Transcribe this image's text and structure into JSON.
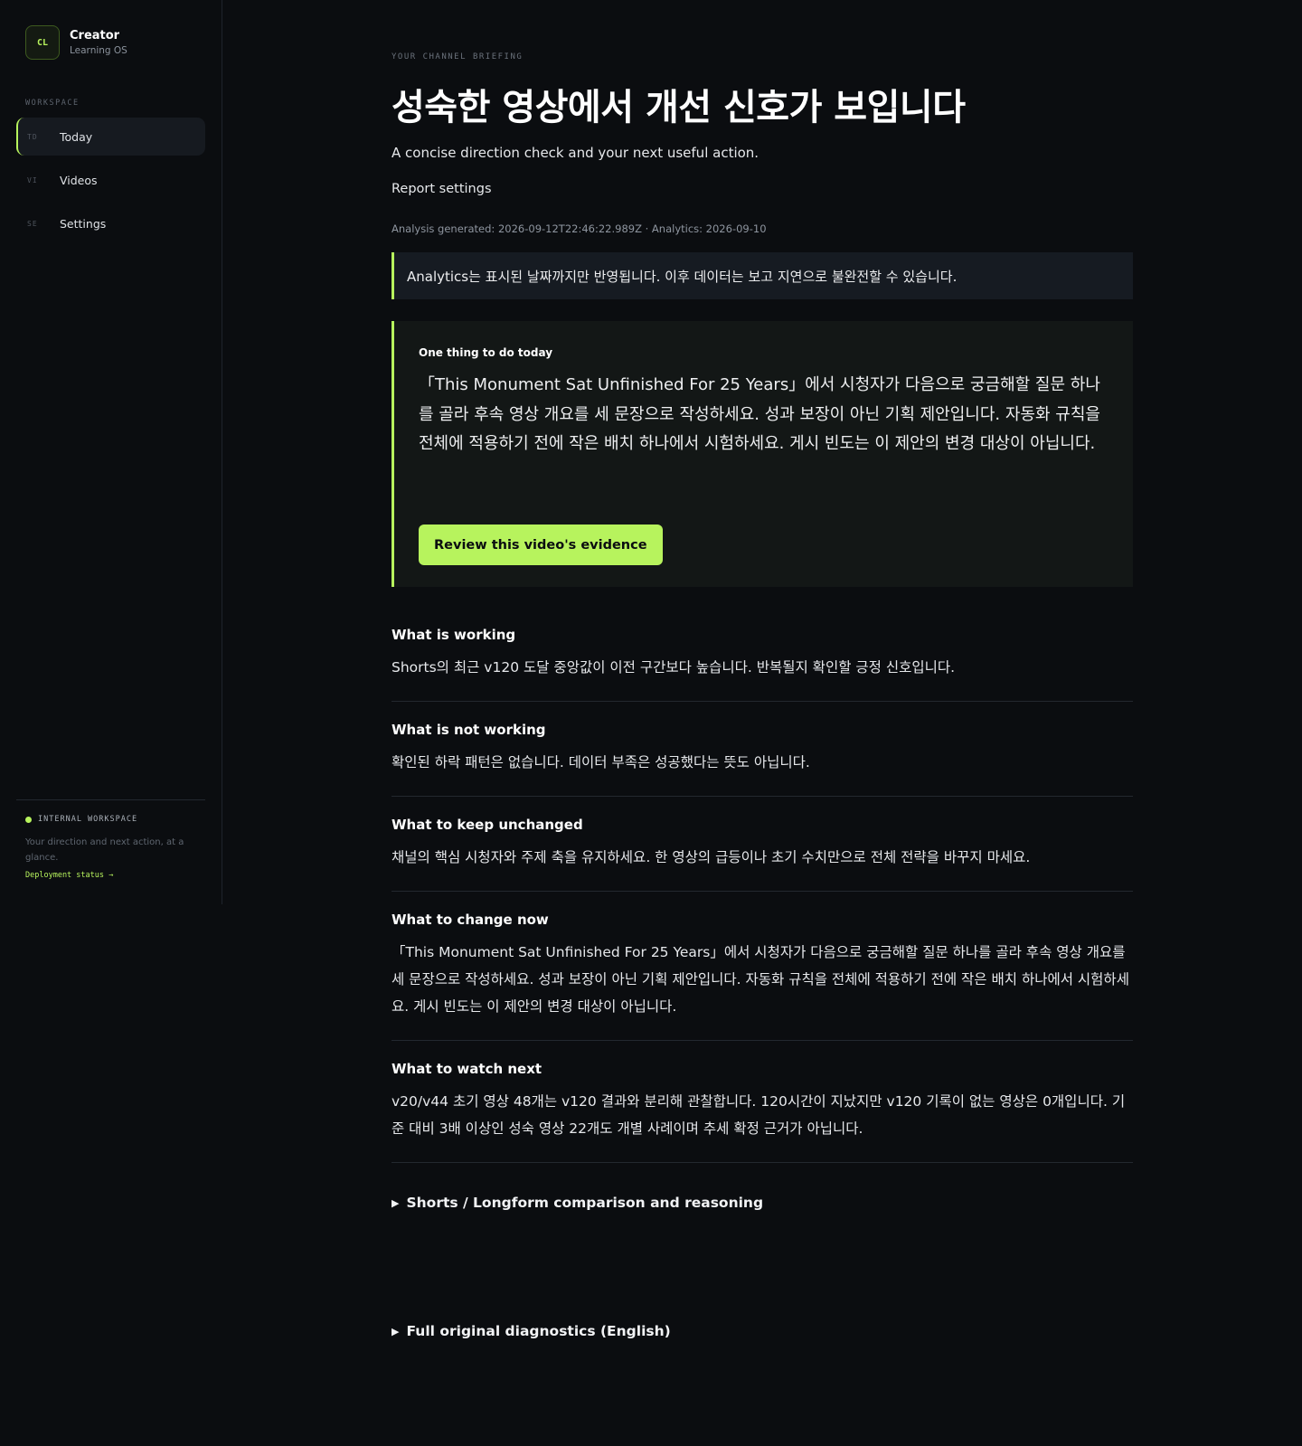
{
  "brand": {
    "logo": "CL",
    "title": "Creator",
    "subtitle": "Learning OS"
  },
  "sidebar": {
    "section_label": "WORKSPACE",
    "items": [
      {
        "code": "TD",
        "label": "Today",
        "active": true
      },
      {
        "code": "VI",
        "label": "Videos",
        "active": false
      },
      {
        "code": "SE",
        "label": "Settings",
        "active": false
      }
    ],
    "footer": {
      "status_label": "INTERNAL WORKSPACE",
      "status_color": "#b7f35d",
      "description": "Your direction and next action, at a glance.",
      "link": "Deployment status →"
    }
  },
  "main": {
    "eyebrow": "YOUR CHANNEL BRIEFING",
    "title": "성숙한 영상에서 개선 신호가 보입니다",
    "subtitle": "A concise direction check and your next useful action.",
    "report_settings": "Report settings",
    "meta": "Analysis generated: 2026-09-12T22:46:22.989Z · Analytics: 2026-09-10",
    "notice": "Analytics는 표시된 날짜까지만 반영됩니다. 이후 데이터는 보고 지연으로 불완전할 수 있습니다.",
    "action_card": {
      "label": "One thing to do today",
      "text": "「This Monument Sat Unfinished For 25 Years」에서 시청자가 다음으로 궁금해할 질문 하나를 골라 후속 영상 개요를 세 문장으로 작성하세요. 성과 보장이 아닌 기획 제안입니다. 자동화 규칙을 전체에 적용하기 전에 작은 배치 하나에서 시험하세요. 게시 빈도는 이 제안의 변경 대상이 아닙니다.",
      "button": "Review this video's evidence"
    },
    "sections": [
      {
        "title": "What is working",
        "body": "Shorts의 최근 v120 도달 중앙값이 이전 구간보다 높습니다. 반복될지 확인할 긍정 신호입니다."
      },
      {
        "title": "What is not working",
        "body": "확인된 하락 패턴은 없습니다. 데이터 부족은 성공했다는 뜻도 아닙니다."
      },
      {
        "title": "What to keep unchanged",
        "body": "채널의 핵심 시청자와 주제 축을 유지하세요. 한 영상의 급등이나 초기 수치만으로 전체 전략을 바꾸지 마세요."
      },
      {
        "title": "What to change now",
        "body": "「This Monument Sat Unfinished For 25 Years」에서 시청자가 다음으로 궁금해할 질문 하나를 골라 후속 영상 개요를 세 문장으로 작성하세요. 성과 보장이 아닌 기획 제안입니다. 자동화 규칙을 전체에 적용하기 전에 작은 배치 하나에서 시험하세요. 게시 빈도는 이 제안의 변경 대상이 아닙니다."
      },
      {
        "title": "What to watch next",
        "body": "v20/v44 초기 영상 48개는 v120 결과와 분리해 관찰합니다. 120시간이 지났지만 v120 기록이 없는 영상은 0개입니다. 기준 대비 3배 이상인 성숙 영상 22개도 개별 사례이며 추세 확정 근거가 아닙니다."
      }
    ],
    "details": [
      {
        "label": "Shorts / Longform comparison and reasoning"
      },
      {
        "label": "Full original diagnostics (English)"
      }
    ]
  }
}
